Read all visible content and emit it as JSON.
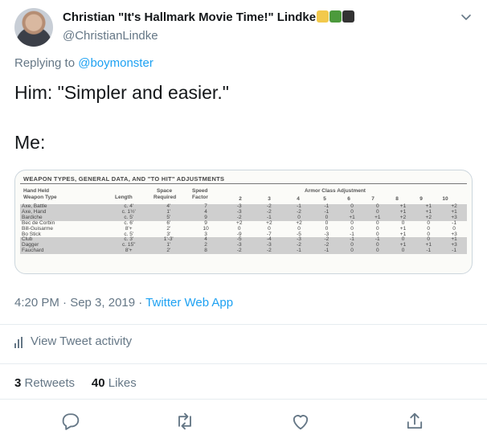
{
  "author": {
    "display_name": "Christian \"It's Hallmark Movie Time!\" Lindke",
    "handle": "@ChristianLindke"
  },
  "reply": {
    "prefix": "Replying to",
    "mention": "@boymonster"
  },
  "tweet": {
    "line1": "Him: \"Simpler and easier.\"",
    "line2": "Me:"
  },
  "image_table": {
    "title": "WEAPON TYPES, GENERAL DATA, AND \"TO HIT\" ADJUSTMENTS",
    "headers": {
      "hand_held": "Hand Held",
      "weapon_type": "Weapon Type",
      "length": "Length",
      "space": "Space",
      "required": "Required",
      "speed": "Speed",
      "factor": "Factor",
      "armor_class": "Armor Class Adjustment",
      "ac": [
        "2",
        "3",
        "4",
        "5",
        "6",
        "7",
        "8",
        "9",
        "10"
      ]
    },
    "rows": [
      [
        "Axe, Battle",
        "c. 4'",
        "4'",
        "7",
        "-3",
        "-2",
        "-1",
        "-1",
        "0",
        "0",
        "+1",
        "+1",
        "+2"
      ],
      [
        "Axe, Hand",
        "c. 1½'",
        "1'",
        "4",
        "-3",
        "-2",
        "-2",
        "-1",
        "0",
        "0",
        "+1",
        "+1",
        "+1"
      ],
      [
        "Bardiche",
        "c. 5'",
        "5'",
        "9",
        "-2",
        "-1",
        "0",
        "0",
        "+1",
        "+1",
        "+2",
        "+2",
        "+3"
      ],
      [
        "Bec de Corbin",
        "c. 6'",
        "6'",
        "9",
        "+2",
        "+2",
        "+2",
        "0",
        "0",
        "0",
        "0",
        "0",
        "-1"
      ],
      [
        "Bill-Guisarme",
        "8'+",
        "2'",
        "10",
        "0",
        "0",
        "0",
        "0",
        "0",
        "0",
        "+1",
        "0",
        "0"
      ],
      [
        "Bo Stick",
        "c. 5'",
        "3'",
        "3",
        "-9",
        "-7",
        "-5",
        "-3",
        "-1",
        "0",
        "+1",
        "0",
        "+3"
      ],
      [
        "Club",
        "c. 3'",
        "1'-3'",
        "4",
        "-5",
        "-4",
        "-3",
        "-2",
        "-1",
        "-1",
        "0",
        "0",
        "+1"
      ],
      [
        "Dagger",
        "c. 15\"",
        "1'",
        "2",
        "-3",
        "-3",
        "-2",
        "-2",
        "0",
        "0",
        "+1",
        "+1",
        "+3"
      ],
      [
        "Fauchard",
        "8'+",
        "2'",
        "8",
        "-2",
        "-2",
        "-1",
        "-1",
        "0",
        "0",
        "0",
        "-1",
        "-1"
      ]
    ]
  },
  "meta": {
    "time": "4:20 PM · Sep 3, 2019 ·",
    "source": "Twitter Web App"
  },
  "activity_label": "View Tweet activity",
  "stats": {
    "retweets_count": "3",
    "retweets_label": "Retweets",
    "likes_count": "40",
    "likes_label": "Likes"
  },
  "colors": {
    "link": "#1da1f2",
    "muted": "#657786",
    "text": "#14171a",
    "divider": "#e6ecf0"
  },
  "icons": [
    "chevron-down-icon",
    "reply-icon",
    "retweet-icon",
    "like-icon",
    "share-icon",
    "bar-chart-icon"
  ]
}
